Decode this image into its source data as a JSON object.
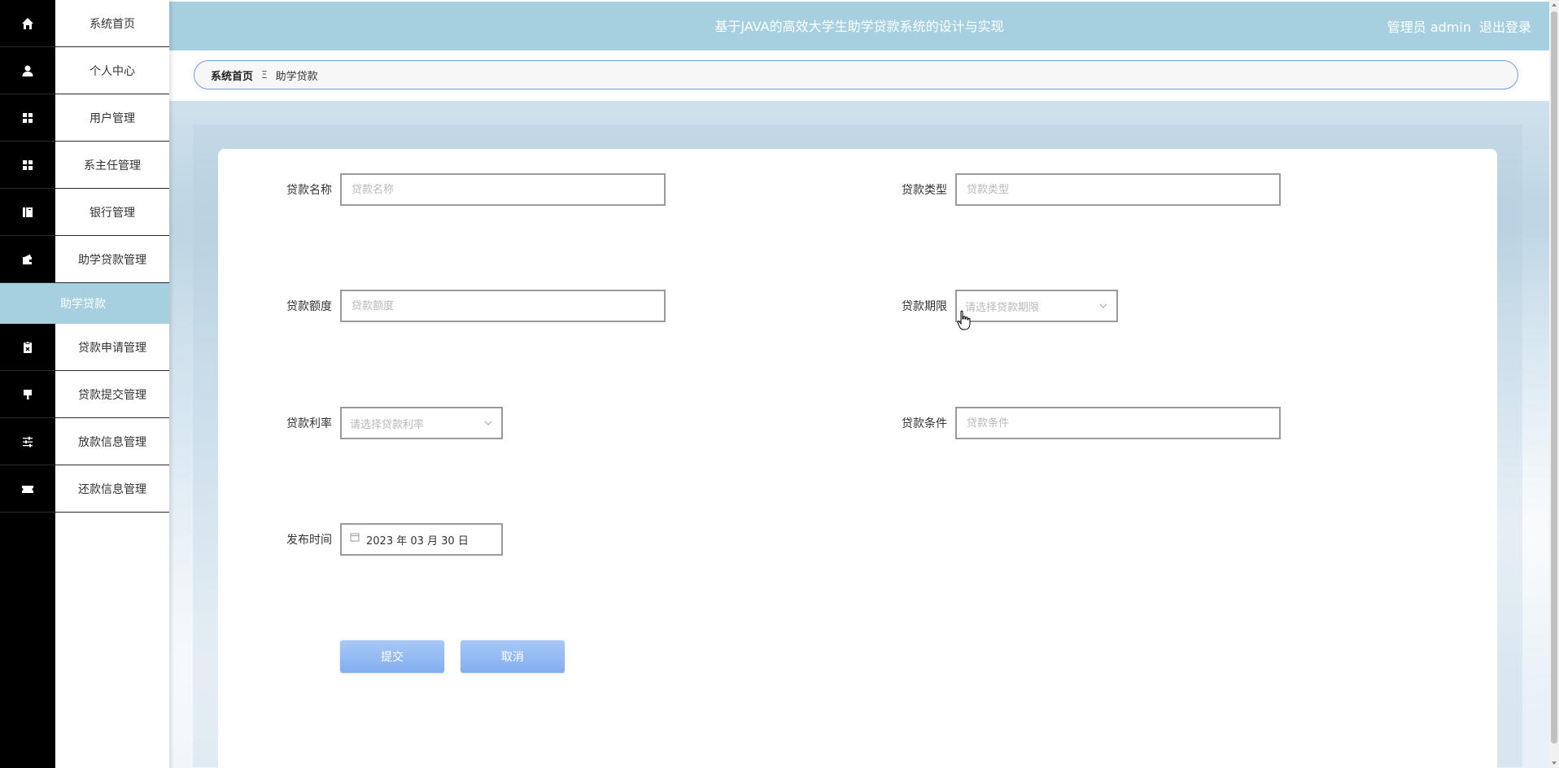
{
  "header": {
    "title": "基于JAVA的高效大学生助学贷款系统的设计与实现",
    "user": "管理员 admin",
    "logout": "退出登录"
  },
  "sidebar": {
    "items": [
      {
        "label": "系统首页",
        "icon": "home-icon"
      },
      {
        "label": "个人中心",
        "icon": "user-icon"
      },
      {
        "label": "用户管理",
        "icon": "grid-icon"
      },
      {
        "label": "系主任管理",
        "icon": "grid-icon"
      },
      {
        "label": "银行管理",
        "icon": "book-icon"
      },
      {
        "label": "助学贷款管理",
        "icon": "wallet-icon"
      },
      {
        "label": "贷款申请管理",
        "icon": "clipboard-icon"
      },
      {
        "label": "贷款提交管理",
        "icon": "stamp-icon"
      },
      {
        "label": "放款信息管理",
        "icon": "sliders-icon"
      },
      {
        "label": "还款信息管理",
        "icon": "ticket-icon"
      }
    ],
    "active_sub": "助学贷款"
  },
  "breadcrumb": {
    "home": "系统首页",
    "separator": "Ξ",
    "current": "助学贷款"
  },
  "form": {
    "loan_name": {
      "label": "贷款名称",
      "placeholder": "贷款名称"
    },
    "loan_type": {
      "label": "贷款类型",
      "placeholder": "贷款类型"
    },
    "loan_amount": {
      "label": "贷款额度",
      "placeholder": "贷款额度"
    },
    "loan_term": {
      "label": "贷款期限",
      "placeholder": "请选择贷款期限"
    },
    "loan_rate": {
      "label": "贷款利率",
      "placeholder": "请选择贷款利率"
    },
    "loan_condition": {
      "label": "贷款条件",
      "placeholder": "贷款条件"
    },
    "publish_time": {
      "label": "发布时间",
      "value": "2023 年 03 月 30 日"
    },
    "submit": "提交",
    "cancel": "取消"
  },
  "colors": {
    "header_bg": "#a6cfe0",
    "sidebar_icon_bg": "#000000",
    "active_bg": "#a6cfe0",
    "button": "#8fb7f2",
    "breadcrumb_border": "#6f97ef"
  }
}
